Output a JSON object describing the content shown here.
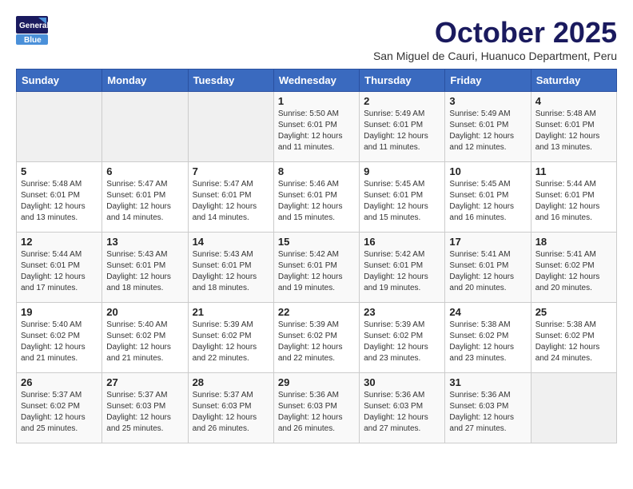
{
  "logo": {
    "line1": "General",
    "line2": "Blue"
  },
  "title": "October 2025",
  "subtitle": "San Miguel de Cauri, Huanuco Department, Peru",
  "days_of_week": [
    "Sunday",
    "Monday",
    "Tuesday",
    "Wednesday",
    "Thursday",
    "Friday",
    "Saturday"
  ],
  "weeks": [
    [
      {
        "day": "",
        "info": ""
      },
      {
        "day": "",
        "info": ""
      },
      {
        "day": "",
        "info": ""
      },
      {
        "day": "1",
        "info": "Sunrise: 5:50 AM\nSunset: 6:01 PM\nDaylight: 12 hours and 11 minutes."
      },
      {
        "day": "2",
        "info": "Sunrise: 5:49 AM\nSunset: 6:01 PM\nDaylight: 12 hours and 11 minutes."
      },
      {
        "day": "3",
        "info": "Sunrise: 5:49 AM\nSunset: 6:01 PM\nDaylight: 12 hours and 12 minutes."
      },
      {
        "day": "4",
        "info": "Sunrise: 5:48 AM\nSunset: 6:01 PM\nDaylight: 12 hours and 13 minutes."
      }
    ],
    [
      {
        "day": "5",
        "info": "Sunrise: 5:48 AM\nSunset: 6:01 PM\nDaylight: 12 hours and 13 minutes."
      },
      {
        "day": "6",
        "info": "Sunrise: 5:47 AM\nSunset: 6:01 PM\nDaylight: 12 hours and 14 minutes."
      },
      {
        "day": "7",
        "info": "Sunrise: 5:47 AM\nSunset: 6:01 PM\nDaylight: 12 hours and 14 minutes."
      },
      {
        "day": "8",
        "info": "Sunrise: 5:46 AM\nSunset: 6:01 PM\nDaylight: 12 hours and 15 minutes."
      },
      {
        "day": "9",
        "info": "Sunrise: 5:45 AM\nSunset: 6:01 PM\nDaylight: 12 hours and 15 minutes."
      },
      {
        "day": "10",
        "info": "Sunrise: 5:45 AM\nSunset: 6:01 PM\nDaylight: 12 hours and 16 minutes."
      },
      {
        "day": "11",
        "info": "Sunrise: 5:44 AM\nSunset: 6:01 PM\nDaylight: 12 hours and 16 minutes."
      }
    ],
    [
      {
        "day": "12",
        "info": "Sunrise: 5:44 AM\nSunset: 6:01 PM\nDaylight: 12 hours and 17 minutes."
      },
      {
        "day": "13",
        "info": "Sunrise: 5:43 AM\nSunset: 6:01 PM\nDaylight: 12 hours and 18 minutes."
      },
      {
        "day": "14",
        "info": "Sunrise: 5:43 AM\nSunset: 6:01 PM\nDaylight: 12 hours and 18 minutes."
      },
      {
        "day": "15",
        "info": "Sunrise: 5:42 AM\nSunset: 6:01 PM\nDaylight: 12 hours and 19 minutes."
      },
      {
        "day": "16",
        "info": "Sunrise: 5:42 AM\nSunset: 6:01 PM\nDaylight: 12 hours and 19 minutes."
      },
      {
        "day": "17",
        "info": "Sunrise: 5:41 AM\nSunset: 6:01 PM\nDaylight: 12 hours and 20 minutes."
      },
      {
        "day": "18",
        "info": "Sunrise: 5:41 AM\nSunset: 6:02 PM\nDaylight: 12 hours and 20 minutes."
      }
    ],
    [
      {
        "day": "19",
        "info": "Sunrise: 5:40 AM\nSunset: 6:02 PM\nDaylight: 12 hours and 21 minutes."
      },
      {
        "day": "20",
        "info": "Sunrise: 5:40 AM\nSunset: 6:02 PM\nDaylight: 12 hours and 21 minutes."
      },
      {
        "day": "21",
        "info": "Sunrise: 5:39 AM\nSunset: 6:02 PM\nDaylight: 12 hours and 22 minutes."
      },
      {
        "day": "22",
        "info": "Sunrise: 5:39 AM\nSunset: 6:02 PM\nDaylight: 12 hours and 22 minutes."
      },
      {
        "day": "23",
        "info": "Sunrise: 5:39 AM\nSunset: 6:02 PM\nDaylight: 12 hours and 23 minutes."
      },
      {
        "day": "24",
        "info": "Sunrise: 5:38 AM\nSunset: 6:02 PM\nDaylight: 12 hours and 23 minutes."
      },
      {
        "day": "25",
        "info": "Sunrise: 5:38 AM\nSunset: 6:02 PM\nDaylight: 12 hours and 24 minutes."
      }
    ],
    [
      {
        "day": "26",
        "info": "Sunrise: 5:37 AM\nSunset: 6:02 PM\nDaylight: 12 hours and 25 minutes."
      },
      {
        "day": "27",
        "info": "Sunrise: 5:37 AM\nSunset: 6:03 PM\nDaylight: 12 hours and 25 minutes."
      },
      {
        "day": "28",
        "info": "Sunrise: 5:37 AM\nSunset: 6:03 PM\nDaylight: 12 hours and 26 minutes."
      },
      {
        "day": "29",
        "info": "Sunrise: 5:36 AM\nSunset: 6:03 PM\nDaylight: 12 hours and 26 minutes."
      },
      {
        "day": "30",
        "info": "Sunrise: 5:36 AM\nSunset: 6:03 PM\nDaylight: 12 hours and 27 minutes."
      },
      {
        "day": "31",
        "info": "Sunrise: 5:36 AM\nSunset: 6:03 PM\nDaylight: 12 hours and 27 minutes."
      },
      {
        "day": "",
        "info": ""
      }
    ]
  ]
}
